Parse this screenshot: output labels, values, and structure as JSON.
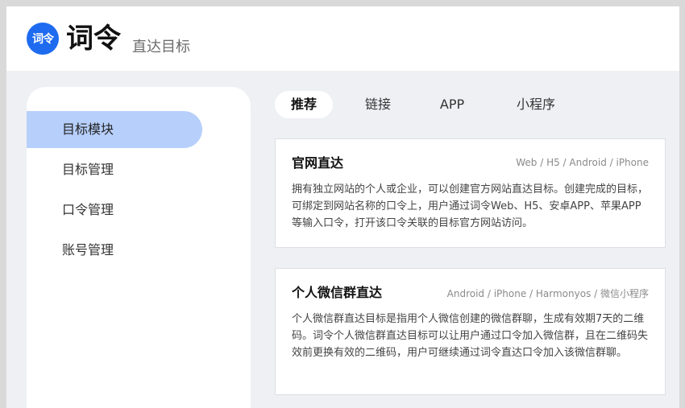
{
  "header": {
    "logo_text": "词令",
    "brand": "词令",
    "tagline": "直达目标"
  },
  "sidebar": {
    "items": [
      {
        "label": "目标模块",
        "active": true
      },
      {
        "label": "目标管理",
        "active": false
      },
      {
        "label": "口令管理",
        "active": false
      },
      {
        "label": "账号管理",
        "active": false
      }
    ]
  },
  "tabs": [
    {
      "label": "推荐",
      "active": true
    },
    {
      "label": "链接",
      "active": false
    },
    {
      "label": "APP",
      "active": false
    },
    {
      "label": "小程序",
      "active": false
    }
  ],
  "cards": [
    {
      "title": "官网直达",
      "platforms": "Web / H5 / Android / iPhone",
      "description": "拥有独立网站的个人或企业，可以创建官方网站直达目标。创建完成的目标，可绑定到网站名称的口令上，用户通过词令Web、H5、安卓APP、苹果APP等输入口令，打开该口令关联的目标官方网站访问。"
    },
    {
      "title": "个人微信群直达",
      "platforms": "Android / iPhone / Harmonyos / 微信小程序",
      "description": "个人微信群直达目标是指用个人微信创建的微信群聊，生成有效期7天的二维码。词令个人微信群直达目标可以让用户通过口令加入微信群，且在二维码失效前更换有效的二维码，用户可继续通过词令直达口令加入该微信群聊。"
    }
  ],
  "colors": {
    "accent": "#1e6bf0",
    "active_sidebar": "#b7cffb",
    "page_bg": "#eef0f3"
  }
}
